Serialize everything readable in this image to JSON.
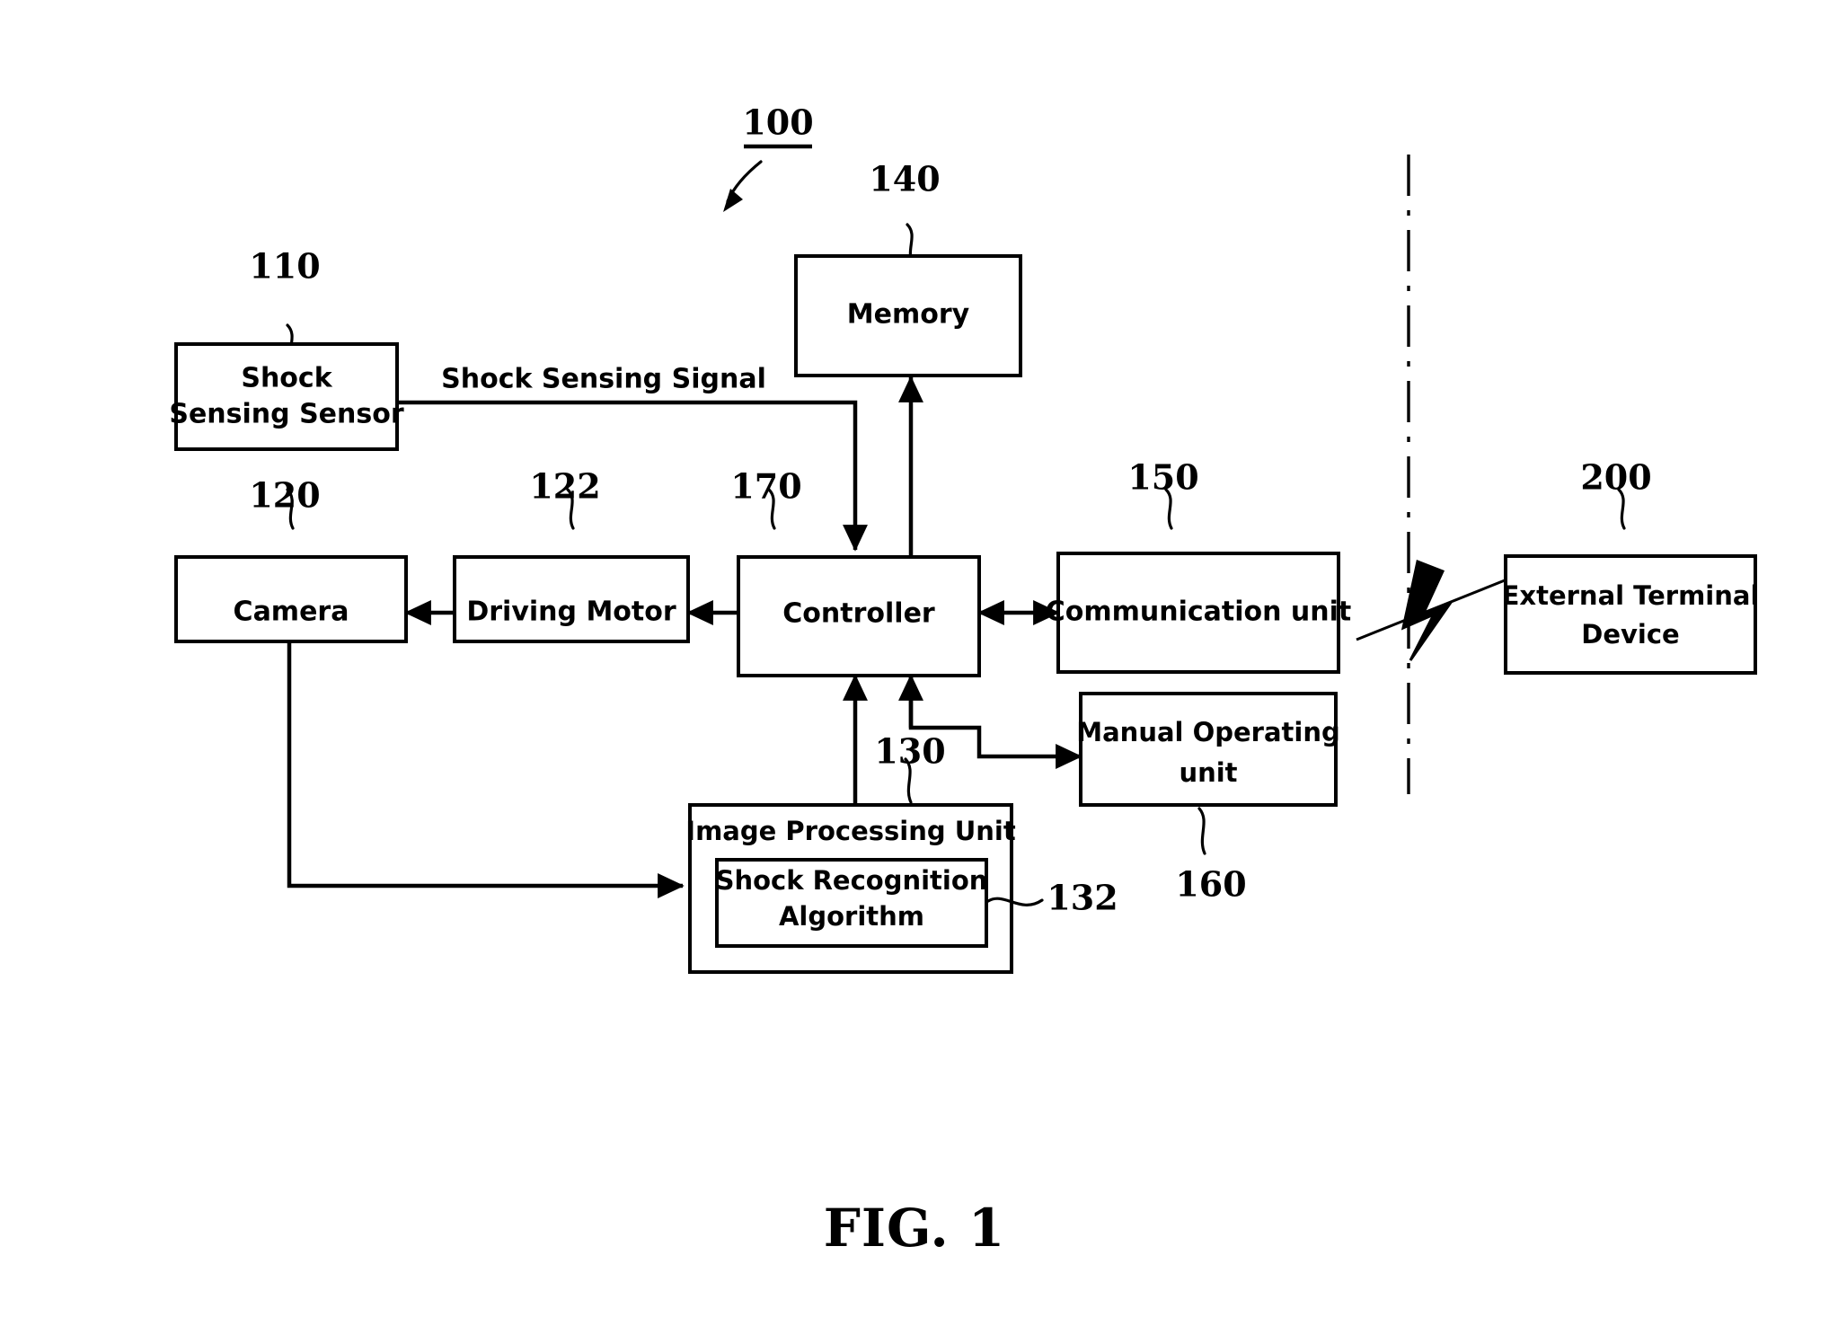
{
  "figure": {
    "caption": "FIG. 1",
    "system_ref": "100"
  },
  "nodes": [
    {
      "id": "shock-sensing-sensor",
      "ref": "110",
      "line1": "Shock",
      "line2": "Sensing Sensor"
    },
    {
      "id": "camera",
      "ref": "120",
      "line1": "Camera",
      "line2": ""
    },
    {
      "id": "driving-motor",
      "ref": "122",
      "line1": "Driving Motor",
      "line2": ""
    },
    {
      "id": "controller",
      "ref": "170",
      "line1": "Controller",
      "line2": ""
    },
    {
      "id": "memory",
      "ref": "140",
      "line1": "Memory",
      "line2": ""
    },
    {
      "id": "communication-unit",
      "ref": "150",
      "line1": "Communication unit",
      "line2": ""
    },
    {
      "id": "external-terminal-device",
      "ref": "200",
      "line1": "External Terminal",
      "line2": "Device"
    },
    {
      "id": "manual-operating-unit",
      "ref": "160",
      "line1": "Manual Operating",
      "line2": "unit"
    },
    {
      "id": "image-processing-unit",
      "ref": "130",
      "line1": "Image Processing Unit",
      "line2": ""
    },
    {
      "id": "shock-recognition-algorithm",
      "ref": "132",
      "line1": "Shock Recognition",
      "line2": "Algorithm"
    }
  ],
  "edges": [
    {
      "id": "shock-signal",
      "label": "Shock Sensing Signal",
      "from": "shock-sensing-sensor",
      "to": "controller"
    },
    {
      "id": "motor-to-camera",
      "label": "",
      "from": "driving-motor",
      "to": "camera"
    },
    {
      "id": "controller-to-motor",
      "label": "",
      "from": "controller",
      "to": "driving-motor"
    },
    {
      "id": "controller-to-memory",
      "label": "",
      "from": "controller",
      "to": "memory"
    },
    {
      "id": "controller-comm",
      "label": "",
      "from": "controller",
      "to": "communication-unit"
    },
    {
      "id": "comm-to-external",
      "label": "",
      "from": "communication-unit",
      "to": "external-terminal-device"
    },
    {
      "id": "camera-to-ipu",
      "label": "",
      "from": "camera",
      "to": "image-processing-unit"
    },
    {
      "id": "ipu-to-controller",
      "label": "",
      "from": "image-processing-unit",
      "to": "controller"
    },
    {
      "id": "manual-to-controller",
      "label": "",
      "from": "manual-operating-unit",
      "to": "controller"
    }
  ],
  "symbols": {
    "wireless_link": "lightning-bolt-icon",
    "boundary": "dash-dot-boundary-line"
  },
  "colors": {
    "stroke": "#000000",
    "background": "#ffffff"
  }
}
